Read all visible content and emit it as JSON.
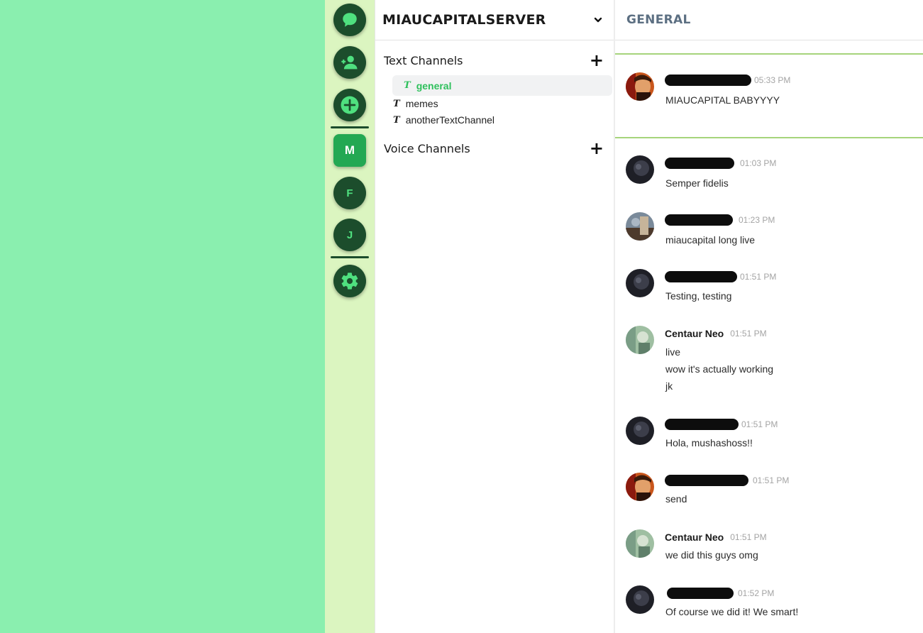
{
  "rail": {
    "icons": [
      "chat-bubble-icon",
      "add-friend-icon",
      "add-server-icon",
      "settings-icon"
    ],
    "servers": [
      {
        "initial": "M",
        "active": true
      },
      {
        "initial": "F",
        "active": false
      },
      {
        "initial": "J",
        "active": false
      }
    ]
  },
  "server": {
    "name": "MIAUCAPITALSERVER",
    "text_channels_label": "Text Channels",
    "voice_channels_label": "Voice Channels",
    "text_channels": [
      {
        "name": "general",
        "selected": true
      },
      {
        "name": "memes",
        "selected": false
      },
      {
        "name": "anotherTextChannel",
        "selected": false
      }
    ],
    "channel_glyph": "T",
    "add_glyph": "+"
  },
  "chat": {
    "title": "GENERAL",
    "messages": [
      {
        "author": "",
        "redacted": true,
        "time": "05:33 PM",
        "lines": [
          "MIAUCAPITAL BABYYYY"
        ]
      },
      {
        "author": "",
        "redacted": true,
        "time": "01:03 PM",
        "lines": [
          "Semper fidelis"
        ]
      },
      {
        "author": "",
        "redacted": true,
        "time": "01:23 PM",
        "lines": [
          "miaucapital long live"
        ]
      },
      {
        "author": "",
        "redacted": true,
        "time": "01:51 PM",
        "lines": [
          "Testing, testing"
        ]
      },
      {
        "author": "Centaur Neo",
        "redacted": false,
        "time": "01:51 PM",
        "lines": [
          "live",
          "wow it's actually working",
          "jk"
        ]
      },
      {
        "author": "",
        "redacted": true,
        "time": "01:51 PM",
        "lines": [
          "Hola, mushashoss!!"
        ]
      },
      {
        "author": "",
        "redacted": true,
        "time": "01:51 PM",
        "lines": [
          "send"
        ]
      },
      {
        "author": "Centaur Neo",
        "redacted": false,
        "time": "01:51 PM",
        "lines": [
          "we did this guys omg"
        ]
      },
      {
        "author": "",
        "redacted": true,
        "time": "01:52 PM",
        "lines": [
          "Of course we did it! We smart!"
        ]
      }
    ]
  },
  "colors": {
    "background": "#8aefaf",
    "rail": "#dbf5c0",
    "rail_button": "#1c4d2c",
    "accent": "#2ec05c",
    "divider": "#a6d47b"
  }
}
